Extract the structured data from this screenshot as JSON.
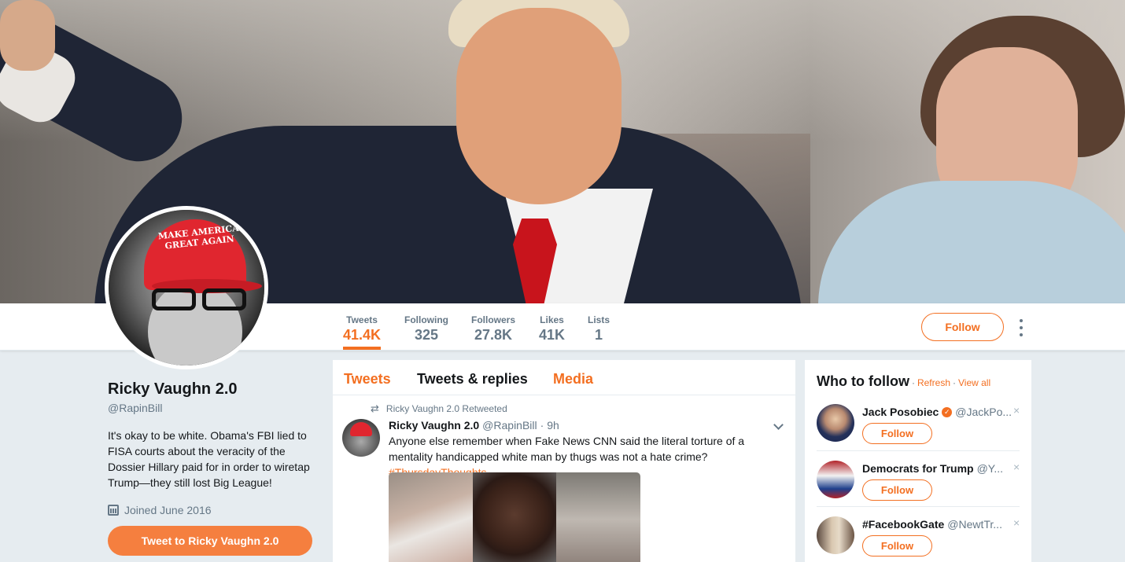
{
  "profile": {
    "name": "Ricky Vaughn 2.0",
    "handle": "@RapinBill",
    "bio": "It's okay to be white. Obama's FBI lied to FISA courts about the veracity of the Dossier Hillary paid for in order to wiretap Trump—they still lost Big League!",
    "joined": "Joined June 2016",
    "tweet_to_label": "Tweet to Ricky Vaughn 2.0",
    "avatar_hat_text": "MAKE AMERICA GREAT AGAIN"
  },
  "stats": [
    {
      "label": "Tweets",
      "value": "41.4K"
    },
    {
      "label": "Following",
      "value": "325"
    },
    {
      "label": "Followers",
      "value": "27.8K"
    },
    {
      "label": "Likes",
      "value": "41K"
    },
    {
      "label": "Lists",
      "value": "1"
    }
  ],
  "header": {
    "follow_label": "Follow"
  },
  "timeline": {
    "tabs": [
      "Tweets",
      "Tweets & replies",
      "Media"
    ],
    "retweet_line": "Ricky Vaughn 2.0 Retweeted",
    "tweet": {
      "author": "Ricky Vaughn 2.0",
      "handle": "@RapinBill",
      "time": "· 9h",
      "text": "Anyone else remember when Fake News CNN said the literal torture of a mentality handicapped white man by thugs was not a hate crime? ",
      "hashtag": "#ThursdayThoughts"
    }
  },
  "who_to_follow": {
    "title": "Who to follow",
    "sep": "·",
    "refresh": "Refresh",
    "view_all": "View all",
    "follow_label": "Follow",
    "close_glyph": "×",
    "items": [
      {
        "name": "Jack Posobiec",
        "handle": "@JackPo...",
        "verified": true
      },
      {
        "name": "Democrats for Trump",
        "handle": "@Y...",
        "verified": false
      },
      {
        "name": "#FacebookGate",
        "handle": "@NewtTr...",
        "verified": false
      }
    ]
  },
  "colors": {
    "accent": "#f36f21",
    "tweet_to_button": "#f57f3f",
    "muted_text": "#657786",
    "page_bg": "#e6ecf0"
  },
  "icons": {
    "retweet": "retweet-icon",
    "calendar": "calendar-icon",
    "verified": "verified-badge-icon",
    "more": "more-vertical-icon",
    "caret": "chevron-down-icon",
    "dismiss": "close-icon"
  },
  "glyphs": {
    "retweet": "⇄",
    "verified": "✓"
  }
}
